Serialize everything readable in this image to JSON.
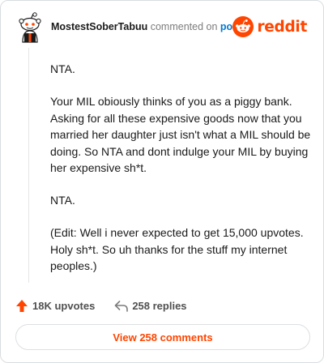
{
  "header": {
    "username": "MostestSoberTabuu",
    "commented_on": "commented on",
    "post_link": "post",
    "brand": "reddit"
  },
  "comment": {
    "paragraphs": [
      "NTA.",
      "Your MIL obiously thinks of you as a piggy bank. Asking for all these expensive goods now that you married her daughter just isn't what a MIL should be doing. So NTA and dont indulge your MIL by buying her expensive sh*t.",
      "NTA.",
      "(Edit: Well i never expected to get 15,000 upvotes. Holy sh*t. So uh thanks for the stuff my internet peoples.)"
    ]
  },
  "footer": {
    "upvotes": "18K upvotes",
    "replies": "258 replies",
    "view_button": "View 258 comments"
  },
  "colors": {
    "accent": "#ff4500",
    "link": "#0079d3",
    "text": "#1a1a1b",
    "muted": "#7c7c7c"
  },
  "icons": [
    "snoo-avatar-icon",
    "reddit-logo-icon",
    "upvote-arrow-icon",
    "reply-arrow-icon"
  ]
}
